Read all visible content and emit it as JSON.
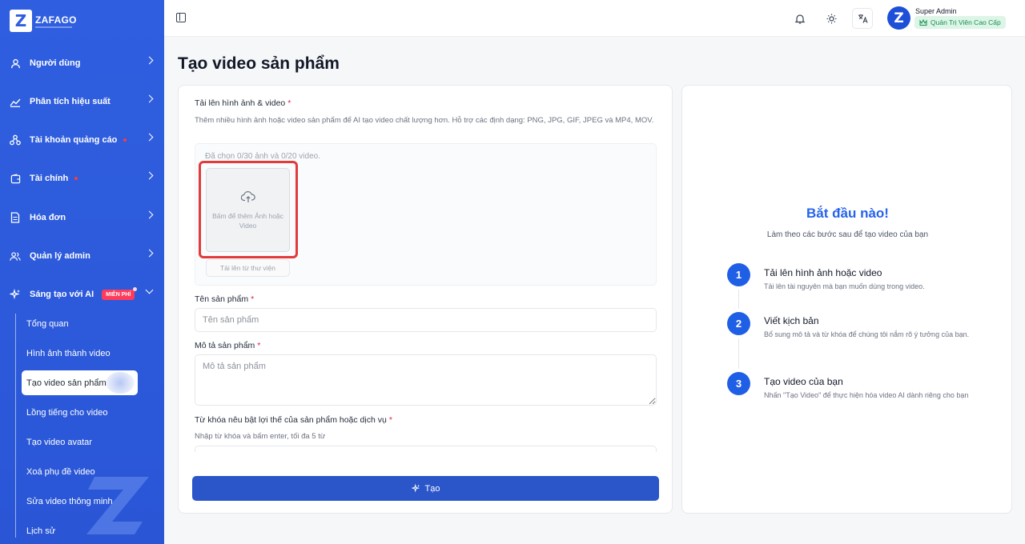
{
  "brand": {
    "logo_letter": "Z",
    "name": "ZAFAGO"
  },
  "sidebar": {
    "items": [
      {
        "label": "Người dùng"
      },
      {
        "label": "Phân tích hiệu suất"
      },
      {
        "label": "Tài khoản quảng cáo"
      },
      {
        "label": "Tài chính"
      },
      {
        "label": "Hóa đơn"
      },
      {
        "label": "Quản lý admin"
      },
      {
        "label": "Sáng tạo với AI",
        "badge": "MIỄN PHÍ"
      }
    ],
    "sub_items": [
      {
        "label": "Tổng quan"
      },
      {
        "label": "Hình ảnh thành video"
      },
      {
        "label": "Tạo video sản phẩm"
      },
      {
        "label": "Lồng tiếng cho video"
      },
      {
        "label": "Tạo video avatar"
      },
      {
        "label": "Xoá phụ đề video"
      },
      {
        "label": "Sửa video thông minh"
      },
      {
        "label": "Lịch sử"
      }
    ]
  },
  "user": {
    "avatar_letter": "Z",
    "name": "Super Admin",
    "role": "Quản Trị Viên Cao Cấp"
  },
  "page": {
    "title": "Tạo video sản phẩm"
  },
  "form": {
    "upload_label": "Tải lên hình ảnh & video",
    "upload_help": "Thêm nhiều hình ảnh hoặc video sản phẩm để AI tạo video chất lượng hơn. Hỗ trợ các định dạng: PNG, JPG, GIF, JPEG và MP4, MOV.",
    "upload_count": "Đã chọn 0/30 ảnh và 0/20 video.",
    "upload_tile_text": "Bấm để thêm Ảnh hoặc Video",
    "library_button": "Tải lên từ thư viện",
    "product_name_label": "Tên sản phẩm",
    "product_name_placeholder": "Tên sản phẩm",
    "product_desc_label": "Mô tả sản phẩm",
    "product_desc_placeholder": "Mô tả sản phẩm",
    "keywords_label": "Từ khóa nêu bật lợi thế của sản phẩm hoặc dịch vụ",
    "keywords_help": "Nhập từ khóa và bấm enter, tối đa 5 từ",
    "submit_label": "Tạo"
  },
  "guide": {
    "title": "Bắt đầu nào!",
    "subtitle": "Làm theo các bước sau để tạo video của bạn",
    "steps": [
      {
        "num": "1",
        "title": "Tải lên hình ảnh hoặc video",
        "desc": "Tải lên tài nguyên mà bạn muốn dùng trong video."
      },
      {
        "num": "2",
        "title": "Viết kịch bản",
        "desc": "Bổ sung mô tả và từ khóa để chúng tôi nắm rõ ý tưởng của bạn."
      },
      {
        "num": "3",
        "title": "Tạo video của bạn",
        "desc": "Nhấn \"Tạo Video\" để thực hiện hóa video AI dành riêng cho bạn"
      }
    ]
  },
  "colors": {
    "sidebar": "#2f5fe0",
    "accent": "#2563eb",
    "submit": "#2a56c9",
    "highlight": "#e23b3b",
    "badge_free": "#ff3b5c",
    "role_badge_bg": "#dcf5e7"
  }
}
